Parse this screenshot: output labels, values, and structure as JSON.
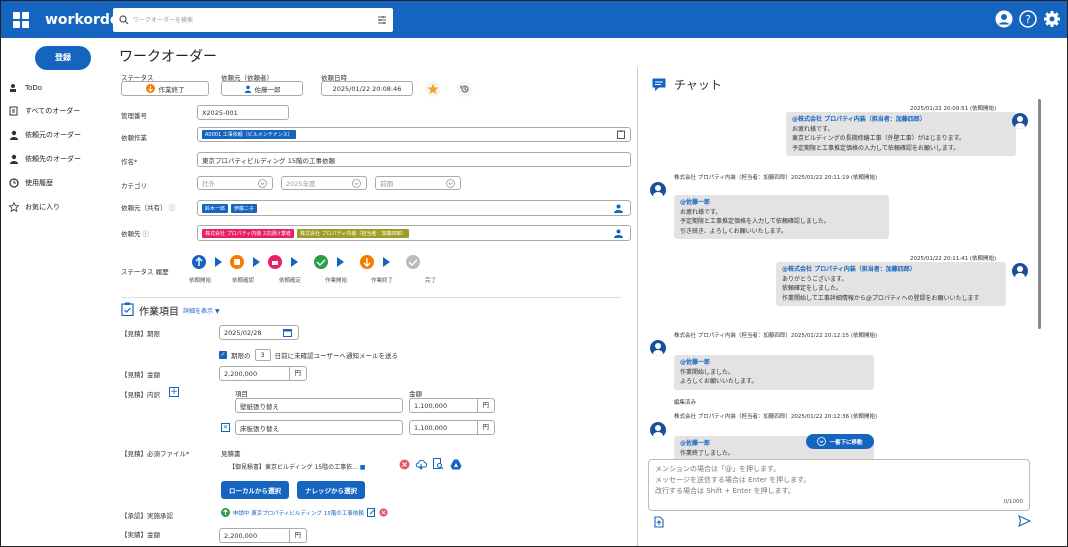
{
  "header": {
    "brand": "workorder",
    "search_placeholder": "ワークオーダーを検索"
  },
  "sidebar": {
    "register": "登録",
    "items": [
      {
        "label": "ToDo"
      },
      {
        "label": "すべてのオーダー"
      },
      {
        "label": "依頼元のオーダー"
      },
      {
        "label": "依頼先のオーダー"
      },
      {
        "label": "使用履歴"
      },
      {
        "label": "お気に入り"
      }
    ]
  },
  "main": {
    "title": "ワークオーダー",
    "status": {
      "label": "ステータス",
      "value": "作業終了"
    },
    "requester": {
      "label": "依頼元（依頼者）",
      "value": "佐藤一郎"
    },
    "requested_at": {
      "label": "依頼日時",
      "value": "2025/01/22 20:08:46"
    },
    "manage_no": {
      "label": "管理番号",
      "value": "X2025-001"
    },
    "request_work": {
      "label": "依頼作業",
      "chip": "A0001 工事依頼（ビルメンテナンス）"
    },
    "subject": {
      "label": "作名*",
      "value": "東京プロパティビルディング 15階の工事依頼"
    },
    "category": {
      "label": "カテゴリ",
      "values": [
        "社外",
        "2025年度",
        "前期"
      ]
    },
    "shared": {
      "label": "依頼元（共有）",
      "chips": [
        "鈴木一郎",
        "伊藤二子"
      ]
    },
    "assignee": {
      "label": "依頼先",
      "chips": [
        "株式会社 プロパティ内装 2次請け業者",
        "株式会社 プロパティ内装（担当者：加藤四郎）"
      ]
    },
    "history": {
      "label": "ステータス 履歴",
      "steps": [
        "依頼開始",
        "依頼確認",
        "依頼確定",
        "作業開始",
        "作業終了",
        "完了"
      ]
    },
    "work_section": {
      "title": "作業項目",
      "detail": "詳細を表示"
    },
    "deadline": {
      "label": "【見積】期限",
      "value": "2025/02/28",
      "notify_prefix": "期限の",
      "notify_days": "3",
      "notify_suffix": "日前に未確認ユーザーへ通知メールを送る"
    },
    "amount": {
      "label": "【見積】金額",
      "value": "2,200,000",
      "unit": "円"
    },
    "breakdown": {
      "label": "【見積】内訳",
      "col_item": "項目",
      "col_amount": "金額",
      "rows": [
        {
          "item": "壁紙張り替え",
          "amount": "1,100,000",
          "unit": "円"
        },
        {
          "item": "床板張り替え",
          "amount": "1,100,000",
          "unit": "円"
        }
      ]
    },
    "files": {
      "label": "【見積】必須ファイル*",
      "heading": "見積書",
      "file": "【御見積書】東京ビルディング 15階の工事依...",
      "local_btn": "ローカルから選択",
      "knowledge_btn": "ナレッジから選択"
    },
    "approval": {
      "label": "【承認】実施承認",
      "value": "申請中 東京プロパティビルディング 15階の工事依頼"
    },
    "actual": {
      "label": "【実績】金額",
      "value": "2,200,000",
      "unit": "円"
    }
  },
  "chat": {
    "title": "チャット",
    "messages": [
      {
        "meta": "2025/01/22 20:09:51 (依頼開始)",
        "mention": "@株式会社 プロパティ内装（担当者：加藤四郎）",
        "lines": [
          "お疲れ様です。",
          "東京ビルディングの長期修繕工事（外壁工事）がはじまります。",
          "予定期限と工事推定価格の入力して依頼確認をお願いします。"
        ]
      },
      {
        "meta": "株式会社 プロパティ内装（担当者：加藤四郎）2025/01/22 20:11:19 (依頼開始)",
        "mention": "@佐藤一郎",
        "lines": [
          "お疲れ様です。",
          "予定期限と工事推定価格を入力して依頼確認しました。",
          "引き続き、よろしくお願いいたします。"
        ]
      },
      {
        "meta": "2025/01/22 20:11:41 (依頼開始)",
        "mention": "@株式会社 プロパティ内装（担当者：加藤四郎）",
        "lines": [
          "ありがとうございます。",
          "依頼確定をしました。",
          "作業開始して工事詳細情報から@プロパティへの登録をお願いいたします"
        ]
      },
      {
        "meta": "株式会社 プロパティ内装（担当者：加藤四郎）2025/01/22 20:12:15 (依頼開始)",
        "mention": "@佐藤一郎",
        "lines": [
          "作業開始しました。",
          "よろしくお願いいたします。"
        ],
        "note": "編集済み"
      },
      {
        "meta": "株式会社 プロパティ内装（担当者：加藤四郎）2025/01/22 20:12:36 (依頼開始)",
        "mention": "@佐藤一郎",
        "lines": [
          "作業終了しました。"
        ]
      }
    ],
    "jump_btn": "一番下に移動",
    "input_lines": [
      "メンションの場合は「@」を押します。",
      "メッセージを送信する場合は Enter を押します。",
      "改行する場合は Shift + Enter を押します。"
    ],
    "counter": "0/1000"
  },
  "colors": {
    "primary": "#1565c0",
    "status_orange": "#f57c00",
    "chip_pink": "#e91e63",
    "chip_olive": "#9e9d24",
    "chip_blue": "#1565c0"
  }
}
